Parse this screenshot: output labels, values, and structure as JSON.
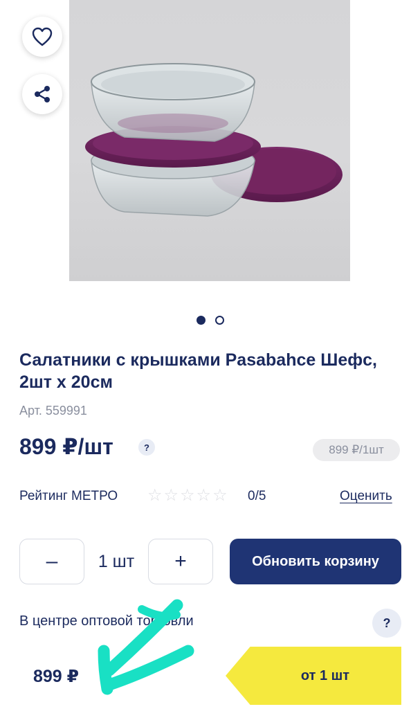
{
  "product": {
    "title": "Салатники с крышками Pasabahce Шефс, 2шт х 20см",
    "sku": "Арт. 559991",
    "price": "899 ₽/шт",
    "price_help": "?",
    "unit_badge": "899 ₽/1шт",
    "image_alt": "Glass bowls with purple lids",
    "gallery": {
      "count": 2,
      "active_index": 0
    }
  },
  "rating": {
    "label": "Рейтинг МЕТРО",
    "score": "0/5",
    "stars_filled": 0,
    "stars_total": 5,
    "rate_link": "Оценить"
  },
  "cart": {
    "minus_label": "–",
    "quantity": "1 шт",
    "plus_label": "+",
    "update_label": "Обновить корзину"
  },
  "wholesale": {
    "title": "В центре оптовой торговли",
    "help": "?",
    "price": "899 ₽",
    "tier_label": "от 1 шт"
  },
  "colors": {
    "primary": "#1f3474",
    "text": "#1b2a5e",
    "tier_yellow": "#f5e93e",
    "annotation": "#19e0c4",
    "lid_purple": "#6b1f5b"
  },
  "icons": {
    "favorite": "heart-icon",
    "share": "share-icon"
  }
}
